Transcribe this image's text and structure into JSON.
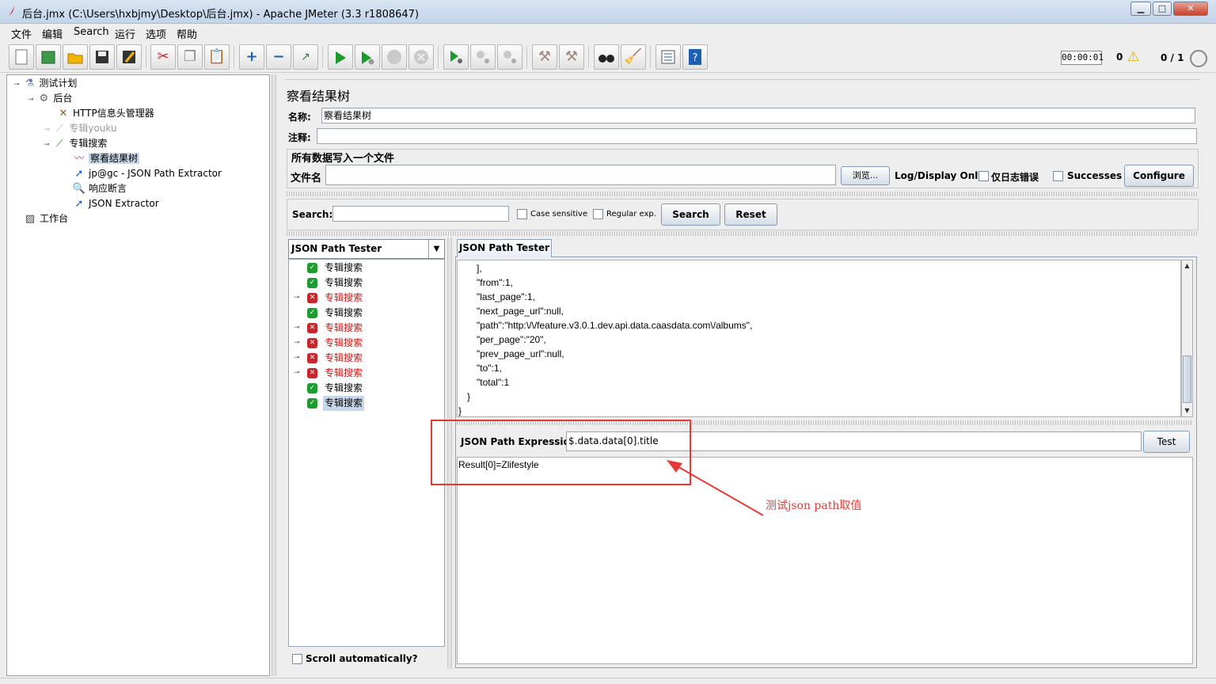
{
  "window": {
    "title": "后台.jmx (C:\\Users\\hxbjmy\\Desktop\\后台.jmx) - Apache JMeter (3.3 r1808647)",
    "minimize": "▁",
    "maximize": "□",
    "close": "✕"
  },
  "menu": [
    "文件",
    "编辑",
    "Search",
    "运行",
    "选项",
    "帮助"
  ],
  "toolbar": {
    "timer": "00:00:01",
    "error_count": "0",
    "threads": "0 / 1"
  },
  "tree": {
    "items": [
      {
        "label": "测试计划",
        "icon": "test-plan-icon"
      },
      {
        "label": "后台",
        "icon": "gear-icon"
      },
      {
        "label": "HTTP信息头管理器",
        "icon": "tools-icon"
      },
      {
        "label": "专辑youku",
        "icon": "pipette-icon",
        "disabled": true
      },
      {
        "label": "专辑搜索",
        "icon": "pipette-icon"
      },
      {
        "label": "察看结果树",
        "icon": "chart-icon",
        "selected": true
      },
      {
        "label": "jp@gc - JSON Path Extractor",
        "icon": "extractor-icon"
      },
      {
        "label": "响应断言",
        "icon": "magnifier-icon"
      },
      {
        "label": "JSON Extractor",
        "icon": "extractor-icon"
      },
      {
        "label": "工作台",
        "icon": "workbench-icon"
      }
    ]
  },
  "panel": {
    "title": "察看结果树",
    "name_label": "名称:",
    "name_value": "察看结果树",
    "comment_label": "注释:",
    "comment_value": "",
    "group_title": "所有数据写入一个文件",
    "file_label": "文件名",
    "file_value": "",
    "browse_label": "浏览...",
    "log_display_label": "Log/Display Only:",
    "errors_label": "仅日志错误",
    "successes_label": "Successes",
    "configure_label": "Configure"
  },
  "search": {
    "label": "Search:",
    "value": "",
    "case_sensitive": "Case sensitive",
    "regex": "Regular exp.",
    "search_button": "Search",
    "reset_button": "Reset"
  },
  "results": {
    "renderer": "JSON Path Tester",
    "items": [
      {
        "label": "专辑搜索",
        "status": "ok"
      },
      {
        "label": "专辑搜索",
        "status": "ok"
      },
      {
        "label": "专辑搜索",
        "status": "fail"
      },
      {
        "label": "专辑搜索",
        "status": "ok"
      },
      {
        "label": "专辑搜索",
        "status": "fail"
      },
      {
        "label": "专辑搜索",
        "status": "fail"
      },
      {
        "label": "专辑搜索",
        "status": "fail"
      },
      {
        "label": "专辑搜索",
        "status": "fail"
      },
      {
        "label": "专辑搜索",
        "status": "ok"
      },
      {
        "label": "专辑搜索",
        "status": "ok",
        "selected": true
      }
    ],
    "scroll_auto": "Scroll automatically?"
  },
  "tester": {
    "tab_label": "JSON Path Tester",
    "response_lines": [
      "],",
      "\"from\":1,",
      "\"last_page\":1,",
      "\"next_page_url\":null,",
      "\"path\":\"http:\\/\\/feature.v3.0.1.dev.api.data.caasdata.com\\/albums\",",
      "\"per_page\":\"20\",",
      "\"prev_page_url\":null,",
      "\"to\":1,",
      "\"total\":1",
      "}",
      "}"
    ],
    "expression_label": "JSON Path Expression",
    "expression_value": "$.data.data[0].title",
    "test_button": "Test",
    "result_text": "Result[0]=Zlifestyle"
  },
  "annotation": "测试json path取值",
  "colors": {
    "accent_red": "#e53935",
    "ok_green": "#1f9c2f",
    "fail_red": "#c8262b"
  }
}
